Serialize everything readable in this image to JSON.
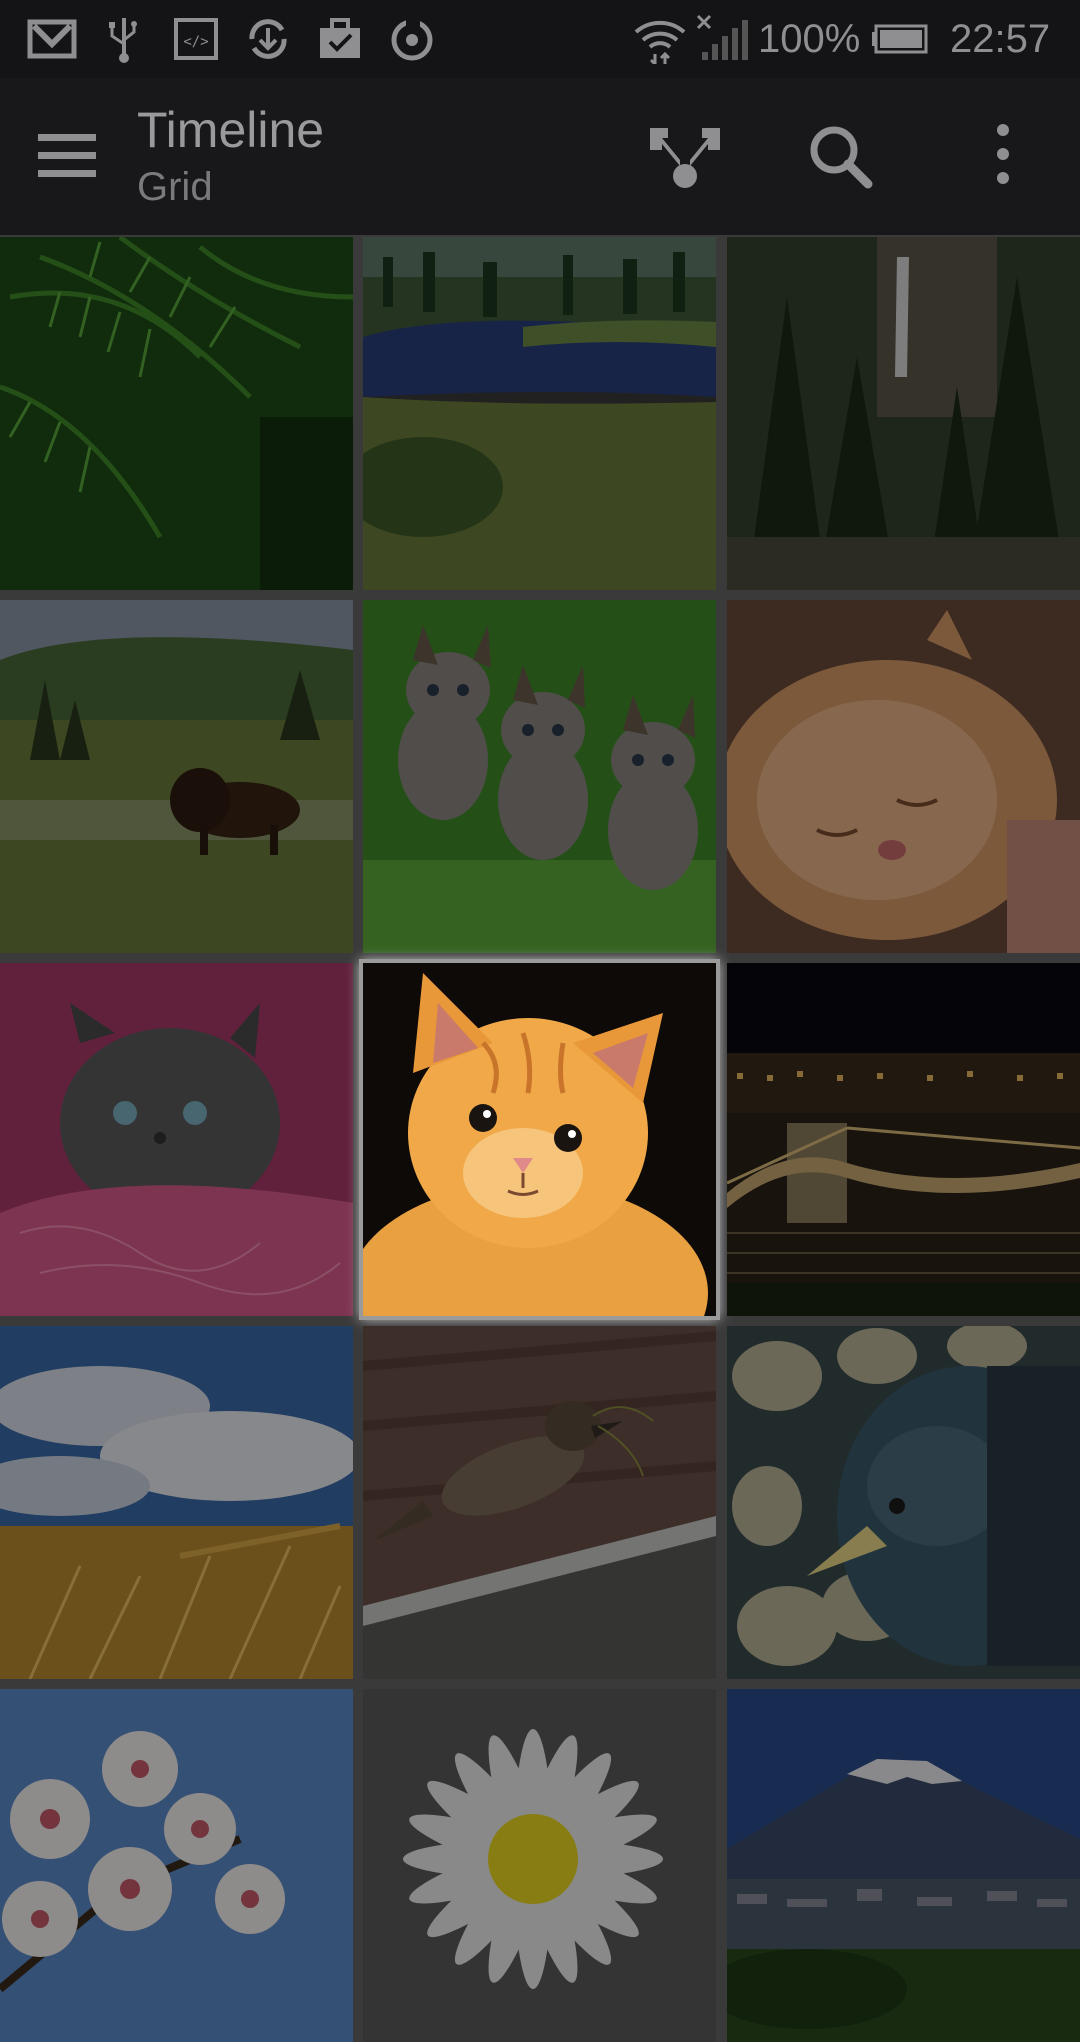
{
  "status_bar": {
    "icons": [
      "gmail-icon",
      "usb-icon",
      "developer-icon",
      "sync-download-icon",
      "briefcase-check-icon",
      "refresh-circle-icon",
      "wifi-icon",
      "no-signal-icon",
      "battery-icon"
    ],
    "battery_text": "100%",
    "time": "22:57"
  },
  "app_bar": {
    "title": "Timeline",
    "subtitle": "Grid",
    "actions": [
      "menu-icon",
      "filter-merge-icon",
      "search-icon",
      "overflow-icon"
    ]
  },
  "grid": {
    "tiles": [
      {
        "subject": "fern"
      },
      {
        "subject": "river"
      },
      {
        "subject": "waterfall"
      },
      {
        "subject": "bison"
      },
      {
        "subject": "kittens"
      },
      {
        "subject": "sleeping-kitten"
      },
      {
        "subject": "grey-kitten"
      },
      {
        "subject": "orange-kitten",
        "highlighted": true
      },
      {
        "subject": "bridge-night"
      },
      {
        "subject": "wheat-sky"
      },
      {
        "subject": "sparrow"
      },
      {
        "subject": "bird-stones"
      },
      {
        "subject": "blossoms"
      },
      {
        "subject": "daisy"
      },
      {
        "subject": "mount-fuji"
      }
    ]
  },
  "colors": {
    "status_bar_bg": "#141416",
    "app_bar_bg": "#18181a",
    "grid_gap": "#3a3a3b",
    "icon_color": "#8f8f91"
  }
}
